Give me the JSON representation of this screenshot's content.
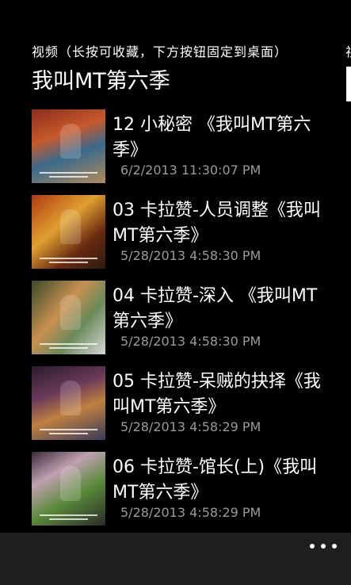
{
  "header": {
    "pivot_label": "视频（长按可收藏，下方按钮固定到桌面）",
    "pivot_next_partial": "视",
    "title": "我叫MT第六季"
  },
  "videos": [
    {
      "title": "12 小秘密 《我叫MT第六季》",
      "time": "6/2/2013 11:30:07 PM"
    },
    {
      "title": "03 卡拉赞-人员调整《我叫MT第六季》",
      "time": "5/28/2013 4:58:30 PM"
    },
    {
      "title": "04 卡拉赞-深入 《我叫MT第六季》",
      "time": "5/28/2013 4:58:30 PM"
    },
    {
      "title": "05 卡拉赞-呆贼的抉择《我叫MT第六季》",
      "time": "5/28/2013 4:58:29 PM"
    },
    {
      "title": "06 卡拉赞-馆长(上)《我叫MT第六季》",
      "time": "5/28/2013 4:58:29 PM"
    }
  ],
  "app_bar": {
    "more_icon": "ellipsis-icon"
  },
  "colors": {
    "background": "#000000",
    "text": "#ffffff",
    "subtext": "#9a9a9a",
    "app_bar": "#1f1f1f"
  }
}
